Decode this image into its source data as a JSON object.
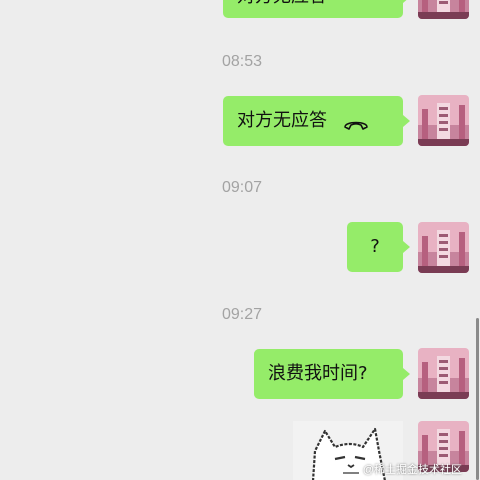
{
  "chat": {
    "messages": [
      {
        "type": "outgoing",
        "text": "对方无应答",
        "icon": "phone-hangup-icon"
      },
      {
        "type": "timestamp",
        "text": "08:53"
      },
      {
        "type": "outgoing",
        "text": "对方无应答",
        "icon": "phone-hangup-icon"
      },
      {
        "type": "timestamp",
        "text": "09:07"
      },
      {
        "type": "outgoing",
        "text": "?"
      },
      {
        "type": "timestamp",
        "text": "09:27"
      },
      {
        "type": "outgoing",
        "text": "浪费我时间?"
      },
      {
        "type": "sticker",
        "description": "cat-sticker"
      }
    ]
  },
  "watermark": {
    "text": "@稀土掘金技术社区"
  },
  "colors": {
    "background": "#ededed",
    "bubble": "#95ec69",
    "timestamp": "#a3a3a3"
  }
}
